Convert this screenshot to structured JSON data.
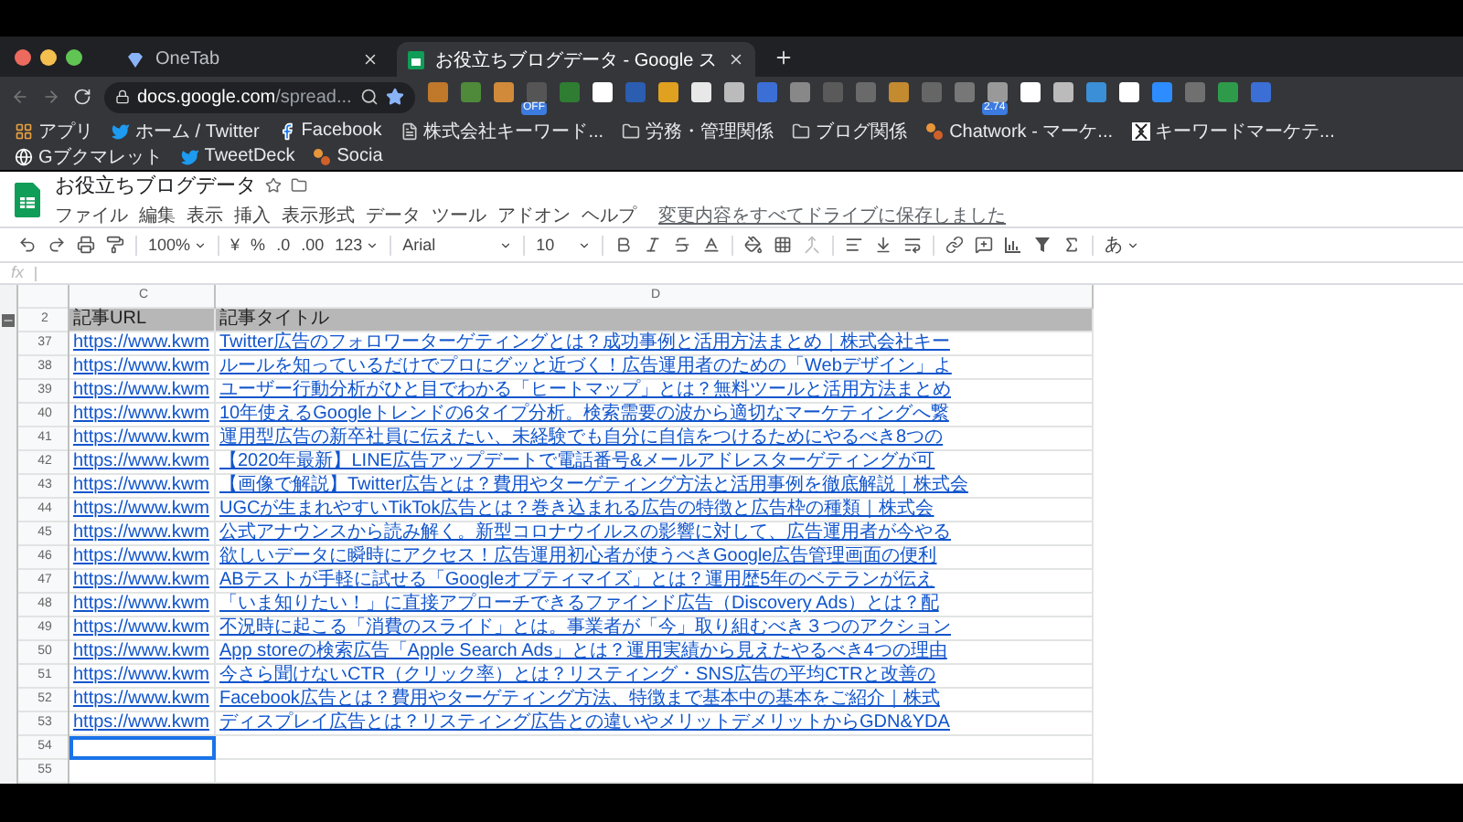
{
  "tabs": [
    {
      "label": "OneTab",
      "selected": false
    },
    {
      "label": "お役立ちブログデータ - Google ス",
      "selected": true
    }
  ],
  "address_bar": {
    "host": "docs.google.com",
    "path": "/spread..."
  },
  "extension_badges": [
    "OFF",
    "2.74"
  ],
  "bookmarks": [
    {
      "label": "アプリ",
      "kind": "apps"
    },
    {
      "label": "ホーム / Twitter",
      "kind": "bird"
    },
    {
      "label": "Facebook",
      "kind": "facebook"
    },
    {
      "label": "株式会社キーワード...",
      "kind": "page"
    },
    {
      "label": "労務・管理関係",
      "kind": "folder"
    },
    {
      "label": "ブログ関係",
      "kind": "folder"
    },
    {
      "label": "Chatwork - マーケ...",
      "kind": "dots"
    },
    {
      "label": "キーワードマーケテ...",
      "kind": "bracket"
    },
    {
      "label": "Gブクマレット",
      "kind": "globe"
    },
    {
      "label": "TweetDeck",
      "kind": "bird"
    },
    {
      "label": "Socia",
      "kind": "dots"
    }
  ],
  "document": {
    "title": "お役立ちブログデータ",
    "menu": [
      "ファイル",
      "編集",
      "表示",
      "挿入",
      "表示形式",
      "データ",
      "ツール",
      "アドオン",
      "ヘルプ"
    ],
    "save_status": "変更内容をすべてドライブに保存しました"
  },
  "toolbar": {
    "zoom": "100%",
    "currency": "¥",
    "percent": "%",
    "decrease_decimals": ".0",
    "increase_decimals": ".00",
    "number_format": "123",
    "font": "Arial",
    "font_size": "10",
    "input_tool": "あ"
  },
  "formula_bar": {
    "label": "fx"
  },
  "grid": {
    "columns": [
      "C",
      "D"
    ],
    "header_row": {
      "number": "2",
      "cells": [
        "記事URL",
        "記事タイトル"
      ]
    },
    "rows": [
      {
        "number": "37",
        "url": "https://www.kwm",
        "title": "Twitter広告のフォロワーターゲティングとは？成功事例と活用方法まとめ｜株式会社キー",
        "selected": false
      },
      {
        "number": "38",
        "url": "https://www.kwm",
        "title": "ルールを知っているだけでプロにグッと近づく！広告運用者のための「Webデザイン」よ",
        "selected": false
      },
      {
        "number": "39",
        "url": "https://www.kwm",
        "title": "ユーザー行動分析がひと目でわかる「ヒートマップ」とは？無料ツールと活用方法まとめ",
        "selected": false
      },
      {
        "number": "40",
        "url": "https://www.kwm",
        "title": "10年使えるGoogleトレンドの6タイプ分析。検索需要の波から適切なマーケティングへ繋",
        "selected": false
      },
      {
        "number": "41",
        "url": "https://www.kwm",
        "title": "運用型広告の新卒社員に伝えたい、未経験でも自分に自信をつけるためにやるべき8つの",
        "selected": false
      },
      {
        "number": "42",
        "url": "https://www.kwm",
        "title": "【2020年最新】LINE広告アップデートで電話番号&メールアドレスターゲティングが可",
        "selected": false
      },
      {
        "number": "43",
        "url": "https://www.kwm",
        "title": "【画像で解説】Twitter広告とは？費用やターゲティング方法と活用事例を徹底解説｜株式会",
        "selected": false
      },
      {
        "number": "44",
        "url": "https://www.kwm",
        "title": "UGCが生まれやすいTikTok広告とは？巻き込まれる広告の特徴と広告枠の種類｜株式会",
        "selected": false
      },
      {
        "number": "45",
        "url": "https://www.kwm",
        "title": "公式アナウンスから読み解く。新型コロナウイルスの影響に対して、広告運用者が今やる",
        "selected": false
      },
      {
        "number": "46",
        "url": "https://www.kwm",
        "title": "欲しいデータに瞬時にアクセス！広告運用初心者が使うべきGoogle広告管理画面の便利",
        "selected": false
      },
      {
        "number": "47",
        "url": "https://www.kwm",
        "title": "ABテストが手軽に試せる「Googleオプティマイズ」とは？運用歴5年のベテランが伝え",
        "selected": false
      },
      {
        "number": "48",
        "url": "https://www.kwm",
        "title": "「いま知りたい！」に直接アプローチできるファインド広告（Discovery Ads）とは？配",
        "selected": false
      },
      {
        "number": "49",
        "url": "https://www.kwm",
        "title": "不況時に起こる「消費のスライド」とは。事業者が「今」取り組むべき３つのアクション",
        "selected": false
      },
      {
        "number": "50",
        "url": "https://www.kwm",
        "title": "App storeの検索広告「Apple Search Ads」とは？運用実績から見えたやるべき4つの理由",
        "selected": false
      },
      {
        "number": "51",
        "url": "https://www.kwm",
        "title": "今さら聞けないCTR（クリック率）とは？リスティング・SNS広告の平均CTRと改善の",
        "selected": false
      },
      {
        "number": "52",
        "url": "https://www.kwm",
        "title": "Facebook広告とは？費用やターゲティング方法、特徴まで基本中の基本をご紹介｜株式",
        "selected": false
      },
      {
        "number": "53",
        "url": "https://www.kwm",
        "title": "ディスプレイ広告とは？リスティング広告との違いやメリットデメリットからGDN&YDA",
        "selected": false
      },
      {
        "number": "54",
        "selected": true
      },
      {
        "number": "55",
        "selected": false
      }
    ]
  }
}
